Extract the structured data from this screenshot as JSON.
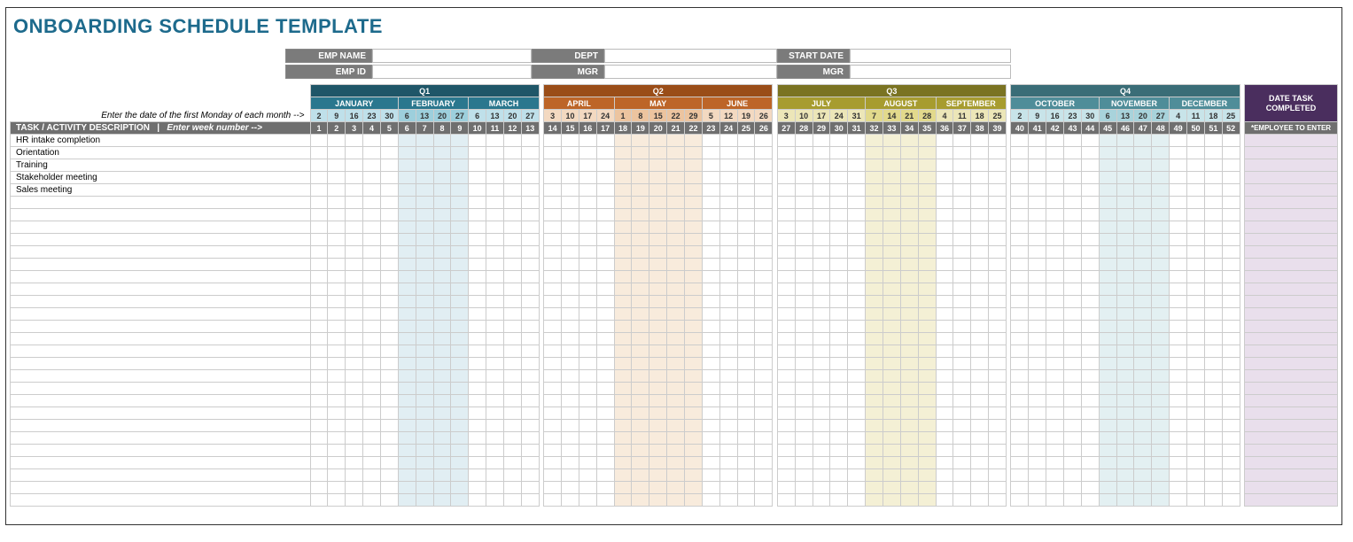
{
  "title": "ONBOARDING SCHEDULE TEMPLATE",
  "form": {
    "r1": {
      "l1": "EMP NAME",
      "l2": "DEPT",
      "l3": "START DATE"
    },
    "r2": {
      "l1": "EMP ID",
      "l2": "MGR",
      "l3": "MGR"
    }
  },
  "quarters": [
    "Q1",
    "Q2",
    "Q3",
    "Q4"
  ],
  "months": [
    "JANUARY",
    "FEBRUARY",
    "MARCH",
    "APRIL",
    "MAY",
    "JUNE",
    "JULY",
    "AUGUST",
    "SEPTEMBER",
    "OCTOBER",
    "NOVEMBER",
    "DECEMBER"
  ],
  "comp_header": "DATE TASK COMPLETED",
  "date_instr": "Enter the date of the first Monday of each month -->",
  "dates": {
    "jan": [
      "2",
      "9",
      "16",
      "23",
      "30"
    ],
    "feb": [
      "6",
      "13",
      "20",
      "27"
    ],
    "mar": [
      "6",
      "13",
      "20",
      "27"
    ],
    "apr": [
      "3",
      "10",
      "17",
      "24"
    ],
    "may": [
      "1",
      "8",
      "15",
      "22",
      "29"
    ],
    "jun": [
      "5",
      "12",
      "19",
      "26"
    ],
    "jul": [
      "3",
      "10",
      "17",
      "24",
      "31"
    ],
    "aug": [
      "7",
      "14",
      "21",
      "28"
    ],
    "sep": [
      "4",
      "11",
      "18",
      "25"
    ],
    "oct": [
      "2",
      "9",
      "16",
      "23",
      "30"
    ],
    "nov": [
      "6",
      "13",
      "20",
      "27"
    ],
    "dec": [
      "4",
      "11",
      "18",
      "25"
    ]
  },
  "task_header_a": "TASK / ACTIVITY DESCRIPTION",
  "task_header_b": "Enter week number -->",
  "weeks": [
    "1",
    "2",
    "3",
    "4",
    "5",
    "6",
    "7",
    "8",
    "9",
    "10",
    "11",
    "12",
    "13",
    "14",
    "15",
    "16",
    "17",
    "18",
    "19",
    "20",
    "21",
    "22",
    "23",
    "24",
    "25",
    "26",
    "27",
    "28",
    "29",
    "30",
    "31",
    "32",
    "33",
    "34",
    "35",
    "36",
    "37",
    "38",
    "39",
    "40",
    "41",
    "42",
    "43",
    "44",
    "45",
    "46",
    "47",
    "48",
    "49",
    "50",
    "51",
    "52"
  ],
  "emp_enter": "*EMPLOYEE TO ENTER",
  "tasks": [
    "HR intake completion",
    "Orientation",
    "Training",
    "Stakeholder meeting",
    "Sales meeting"
  ],
  "blank_rows": 25
}
